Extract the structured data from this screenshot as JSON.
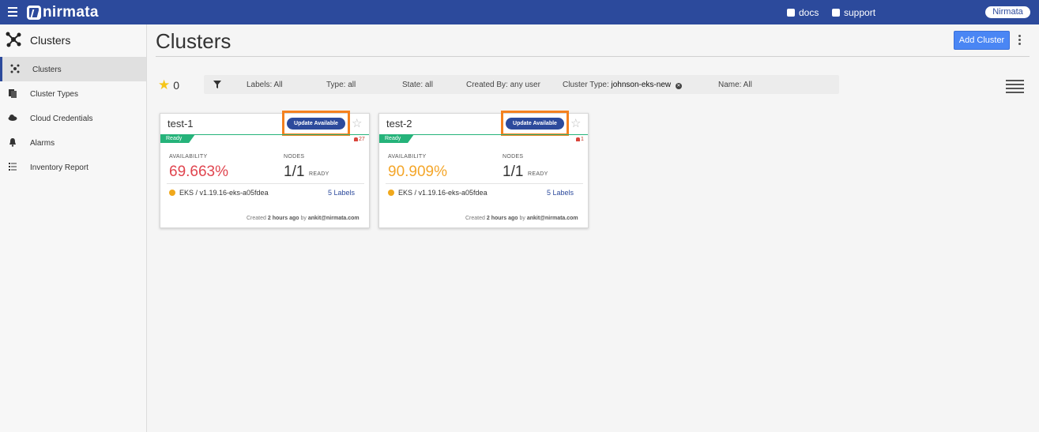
{
  "topbar": {
    "brand": "nirmata",
    "docs_label": "docs",
    "support_label": "support",
    "user_label": "Nirmata"
  },
  "sidebar": {
    "title": "Clusters",
    "items": [
      {
        "label": "Clusters",
        "icon": "clusters-icon"
      },
      {
        "label": "Cluster Types",
        "icon": "cluster-types-icon"
      },
      {
        "label": "Cloud Credentials",
        "icon": "cloud-icon"
      },
      {
        "label": "Alarms",
        "icon": "bell-icon"
      },
      {
        "label": "Inventory Report",
        "icon": "list-icon"
      }
    ]
  },
  "main": {
    "title": "Clusters",
    "add_button": "Add Cluster",
    "favorites_count": "0"
  },
  "filters": {
    "labels": "Labels: All",
    "type": "Type: all",
    "state": "State: all",
    "created_by": "Created By: any user",
    "cluster_type_label": "Cluster Type:",
    "cluster_type_value": "johnson-eks-new",
    "name": "Name: All"
  },
  "cards": [
    {
      "name": "test-1",
      "update_label": "Update Available",
      "status": "Ready",
      "alarms": "27",
      "availability_label": "AVAILABILITY",
      "availability": "69.663%",
      "availability_color": "#e0454f",
      "nodes_label": "NODES",
      "nodes": "1/1",
      "nodes_state": "READY",
      "version": "EKS / v1.19.16-eks-a05fdea",
      "labels": "5 Labels",
      "created_prefix": "Created",
      "created_time": "2 hours ago",
      "created_by_word": "by",
      "created_by": "ankit@nirmata.com"
    },
    {
      "name": "test-2",
      "update_label": "Update Available",
      "status": "Ready",
      "alarms": "1",
      "availability_label": "AVAILABILITY",
      "availability": "90.909%",
      "availability_color": "#f4a62a",
      "nodes_label": "NODES",
      "nodes": "1/1",
      "nodes_state": "READY",
      "version": "EKS / v1.19.16-eks-a05fdea",
      "labels": "5 Labels",
      "created_prefix": "Created",
      "created_time": "2 hours ago",
      "created_by_word": "by",
      "created_by": "ankit@nirmata.com"
    }
  ],
  "colors": {
    "brand": "#2c4a9c",
    "accent_button": "#4a86f4",
    "ready": "#25b37a",
    "highlight": "#f4811f"
  }
}
